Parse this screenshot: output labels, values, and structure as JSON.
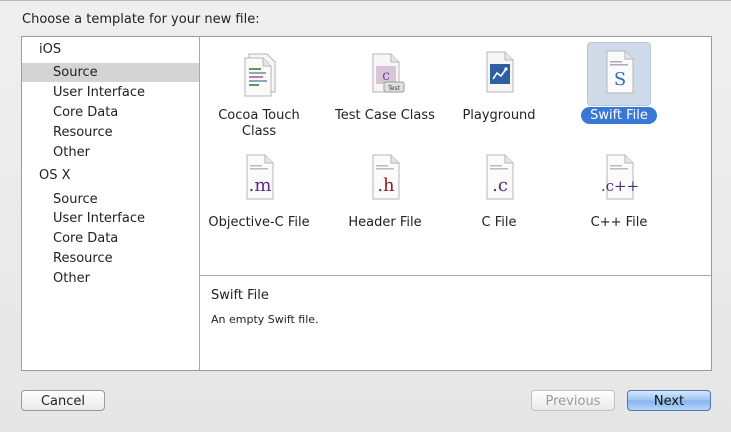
{
  "dialog": {
    "prompt": "Choose a template for your new file:"
  },
  "sidebar": {
    "groups": [
      {
        "name": "iOS",
        "items": [
          "Source",
          "User Interface",
          "Core Data",
          "Resource",
          "Other"
        ]
      },
      {
        "name": "OS X",
        "items": [
          "Source",
          "User Interface",
          "Core Data",
          "Resource",
          "Other"
        ]
      }
    ],
    "selected": "iOS / Source"
  },
  "templates": [
    {
      "label": "Cocoa Touch Class",
      "icon": "cocoa-touch-class-icon"
    },
    {
      "label": "Test Case Class",
      "icon": "test-case-class-icon",
      "badge": "Test"
    },
    {
      "label": "Playground",
      "icon": "playground-icon"
    },
    {
      "label": "Swift File",
      "icon": "swift-file-icon",
      "glyph": "S"
    },
    {
      "label": "Objective-C File",
      "icon": "objective-c-file-icon",
      "glyph": ".m"
    },
    {
      "label": "Header File",
      "icon": "header-file-icon",
      "glyph": ".h"
    },
    {
      "label": "C File",
      "icon": "c-file-icon",
      "glyph": ".c"
    },
    {
      "label": "C++ File",
      "icon": "cpp-file-icon",
      "glyph": ".c++"
    }
  ],
  "selected_template": "Swift File",
  "description": {
    "title": "Swift File",
    "text": "An empty Swift file."
  },
  "buttons": {
    "cancel": "Cancel",
    "previous": "Previous",
    "next": "Next"
  },
  "colors": {
    "selection_blue": "#3a78d6",
    "objc_purple": "#5b2a86",
    "header_red": "#8b1e1e",
    "swift_blue": "#2f6fb0"
  }
}
